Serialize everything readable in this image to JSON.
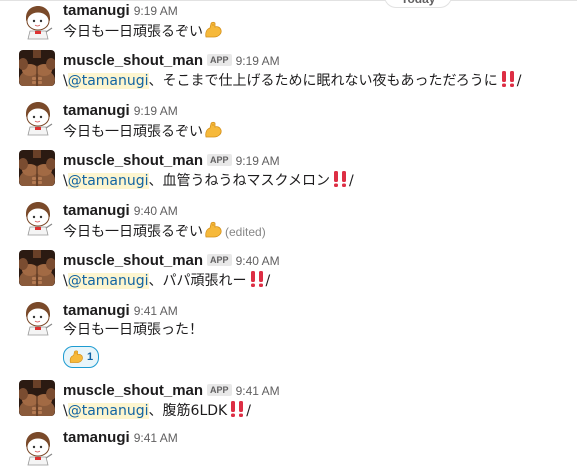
{
  "divider": {
    "label": "Today"
  },
  "messages": [
    {
      "user": "tamanugi",
      "time": "9:19 AM",
      "text": "今日も一日頑張るぞい"
    },
    {
      "user": "muscle_shout_man",
      "badge": "APP",
      "time": "9:19 AM",
      "prefix": "\\",
      "mention": "@tamanugi",
      "text": "、そこまで仕上げるために眠れない夜もあっただろうに",
      "suffix": "/"
    },
    {
      "user": "tamanugi",
      "time": "9:19 AM",
      "text": "今日も一日頑張るぞい"
    },
    {
      "user": "muscle_shout_man",
      "badge": "APP",
      "time": "9:19 AM",
      "prefix": "\\",
      "mention": "@tamanugi",
      "text": "、血管うねうねマスクメロン",
      "suffix": "/"
    },
    {
      "user": "tamanugi",
      "time": "9:40 AM",
      "text": "今日も一日頑張るぞい",
      "edited": "(edited)"
    },
    {
      "user": "muscle_shout_man",
      "badge": "APP",
      "time": "9:40 AM",
      "prefix": "\\",
      "mention": "@tamanugi",
      "text": "、パパ頑張れー",
      "suffix": "/"
    },
    {
      "user": "tamanugi",
      "time": "9:41 AM",
      "text": "今日も一日頑張った！",
      "reaction": {
        "emoji": "muscle",
        "count": "1"
      }
    },
    {
      "user": "muscle_shout_man",
      "badge": "APP",
      "time": "9:41 AM",
      "prefix": "\\",
      "mention": "@tamanugi",
      "text": "、腹筋6LDK",
      "suffix": "/"
    },
    {
      "user": "tamanugi",
      "time": "9:41 AM"
    }
  ],
  "colors": {
    "mention_bg": "#fdf5cf",
    "mention_text": "#1264a3",
    "reaction_border": "#1d9bd1",
    "bangs": "#dd2e44",
    "muscle": "#f4b400"
  },
  "icons": {
    "muscle": "flexed-biceps-icon",
    "bangs": "double-exclamation-icon"
  }
}
